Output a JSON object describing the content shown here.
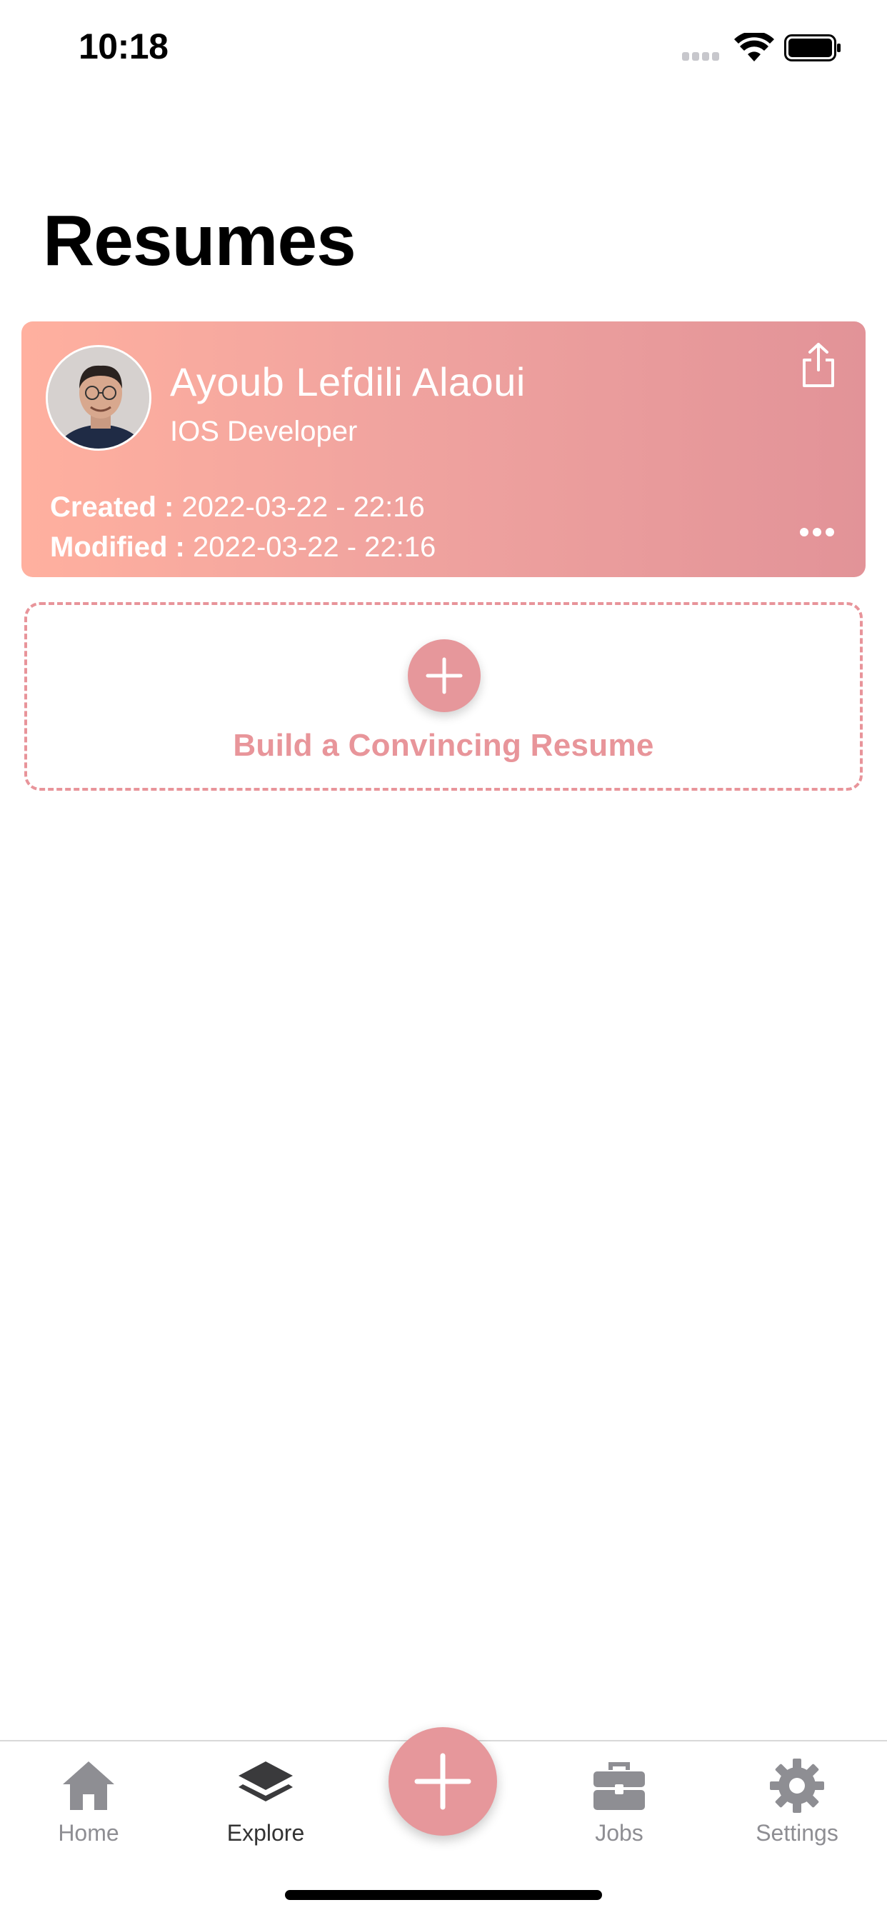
{
  "status_bar": {
    "time": "10:18"
  },
  "page": {
    "title": "Resumes"
  },
  "resume": {
    "name": "Ayoub Lefdili Alaoui",
    "role": "IOS Developer",
    "created_label": "Created :",
    "created_value": "2022-03-22 - 22:16",
    "modified_label": "Modified :",
    "modified_value": "2022-03-22 - 22:16"
  },
  "build": {
    "label": "Build a Convincing Resume"
  },
  "tabs": [
    {
      "label": "Home",
      "icon": "home-icon",
      "active": false
    },
    {
      "label": "Explore",
      "icon": "layers-icon",
      "active": true
    },
    {
      "label": "Jobs",
      "icon": "briefcase-icon",
      "active": false
    },
    {
      "label": "Settings",
      "icon": "gear-icon",
      "active": false
    }
  ],
  "colors": {
    "accent": "#e6979b",
    "card_gradient_start": "#ffb09f",
    "card_gradient_end": "#e29398",
    "tab_inactive": "#8e8e93",
    "tab_active": "#333333"
  }
}
